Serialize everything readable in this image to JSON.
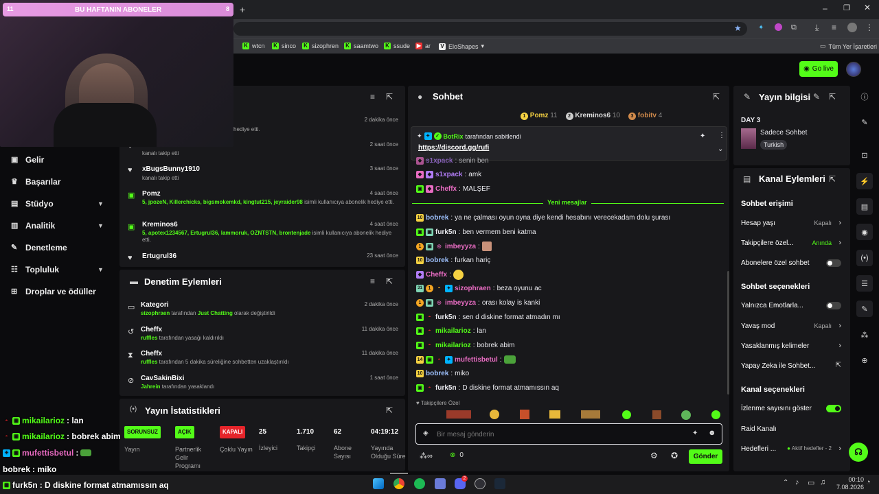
{
  "webcam": {
    "banner_left": "11",
    "banner_text": "BU HAFTANIN ABONELER",
    "banner_right": "8"
  },
  "browser": {
    "new_tab": "+",
    "bookmarks": [
      {
        "label": "wtcn"
      },
      {
        "label": "sinco"
      },
      {
        "label": "sizophren"
      },
      {
        "label": "saamtwo"
      },
      {
        "label": "ssude"
      },
      {
        "label": "ar"
      },
      {
        "label": "EloShapes"
      }
    ],
    "all_bookmarks": "Tüm Yer İşaretleri"
  },
  "header": {
    "go_live": "Go live"
  },
  "sidebar": {
    "items": [
      {
        "label": "Gelir"
      },
      {
        "label": "Başarılar"
      },
      {
        "label": "Stüdyo"
      },
      {
        "label": "Analitik"
      },
      {
        "label": "Denetleme"
      },
      {
        "label": "Topluluk"
      },
      {
        "label": "Droplar ve ödüller"
      }
    ]
  },
  "activity": {
    "rows": [
      {
        "name": "",
        "sub": "hediye etti.",
        "time": "2 dakika önce"
      },
      {
        "name": "",
        "sub": "kanalı takip etti",
        "time": "2 saat önce"
      },
      {
        "name": "xBugsBunny1910",
        "sub": "kanalı takip etti",
        "time": "3 saat önce"
      },
      {
        "name": "Pomz",
        "sub_green": "5, jpozeN, Killerchicks, bigsmokemkd, kingtut215, jeyraider98",
        "sub": " isimli kullanıcıya abonelik hediye etti.",
        "time": "4 saat önce"
      },
      {
        "name": "Kreminos6",
        "sub_green": "5, apotex1234567, Ertugrul36, lammoruk, OZNTSTN, brontenjade",
        "sub": " isimli kullanıcıya abonelik hediye etti.",
        "time": "4 saat önce"
      },
      {
        "name": "Ertugrul36",
        "sub": "",
        "time": "23 saat önce"
      }
    ]
  },
  "moderation": {
    "title": "Denetim Eylemleri",
    "rows": [
      {
        "name": "Kategori",
        "actor": "sizophraen",
        "mid": " tarafından ",
        "target": "Just Chatting",
        "end": " olarak değiştirildi",
        "time": "2 dakika önce"
      },
      {
        "name": "Cheffx",
        "actor": "ruffles",
        "mid": " tarafından yasağı kaldırıldı",
        "target": "",
        "end": "",
        "time": "11 dakika önce"
      },
      {
        "name": "Cheffx",
        "actor": "ruffles",
        "mid": " tarafından 5 dakika süreliğine sohbetten uzaklaştırıldı",
        "target": "",
        "end": "",
        "time": "11 dakika önce"
      },
      {
        "name": "CavSakinBixi",
        "actor": "Jahrein",
        "mid": " tarafından yasaklandı",
        "target": "",
        "end": "",
        "time": "1 saat önce"
      }
    ]
  },
  "stats": {
    "title": "Yayın İstatistikleri",
    "items": [
      {
        "tag": "SORUNSUZ",
        "tag_color": "#53fc18",
        "label": "Yayın"
      },
      {
        "tag": "AÇIK",
        "tag_color": "#53fc18",
        "label": "Partnerlik Gelir Programı"
      },
      {
        "tag": "KAPALI",
        "tag_color": "#e5242a",
        "label": "Çoklu Yayın"
      },
      {
        "value": "25",
        "label": "İzleyici"
      },
      {
        "value": "1.710",
        "label": "Takipçi"
      },
      {
        "value": "62",
        "label": "Abone Sayısı"
      },
      {
        "value": "04:19:12",
        "label": "Yayında Olduğu Süre"
      }
    ]
  },
  "chat": {
    "title": "Sohbet",
    "top_gifters": [
      {
        "name": "Pomz",
        "count": "11"
      },
      {
        "name": "Kreminos6",
        "count": "10"
      },
      {
        "name": "fobitv",
        "count": "4"
      }
    ],
    "pinned": {
      "by": "BotRix",
      "by_suffix": "tarafından sabitlendi",
      "link": "https://discord.gg/rufi"
    },
    "messages_before": [
      {
        "user": "s1xpack",
        "text": "senin ben",
        "color": "#b17cf5"
      },
      {
        "user": "s1xpack",
        "text": "amk",
        "color": "#b17cf5"
      },
      {
        "user": "Cheffx",
        "text": "MALŞEF",
        "color": "#e86cc2"
      }
    ],
    "new_divider": "Yeni mesajlar",
    "messages": [
      {
        "badge": "10",
        "user": "bobrek",
        "text": "ya ne çalması oyun oyna diye kendi hesabını verecekadam dolu şurası",
        "color": "#9fc2ff"
      },
      {
        "user": "furk5n",
        "text": "ben vermem beni katma",
        "color": "#ffffff"
      },
      {
        "user": "imbeyyza",
        "text": "",
        "color": "#e86cc2"
      },
      {
        "badge": "10",
        "user": "bobrek",
        "text": "furkan hariç",
        "color": "#9fc2ff"
      },
      {
        "user": "Cheffx",
        "text": "",
        "color": "#e86cc2"
      },
      {
        "user": "sizophraen",
        "text": "beza oyunu ac",
        "color": "#e86cc2"
      },
      {
        "user": "imbeyyza",
        "text": "orası kolay is kanki",
        "color": "#e86cc2"
      },
      {
        "user": "furk5n",
        "text": "sen d diskine format atmadın mı",
        "color": "#ffffff"
      },
      {
        "user": "mikailarioz",
        "text": "lan",
        "color": "#53fc18"
      },
      {
        "user": "mikailarioz",
        "text": "bobrek abim",
        "color": "#53fc18"
      },
      {
        "badge": "14",
        "user": "mufettisbetul",
        "text": "",
        "color": "#e86cc2"
      },
      {
        "badge": "10",
        "user": "bobrek",
        "text": "miko",
        "color": "#9fc2ff"
      },
      {
        "user": "furk5n",
        "text": "D diskine format atmamıssın aq",
        "color": "#ffffff"
      }
    ],
    "emote_label": "Takipçilere Özel",
    "input_placeholder": "Bir mesaj gönderin",
    "points": "0",
    "send": "Gönder"
  },
  "stream_info": {
    "title": "Yayın bilgisi",
    "stream_title": "DAY 3",
    "category": "Sadece Sohbet",
    "language": "Turkish"
  },
  "channel_actions": {
    "title": "Kanal Eylemleri",
    "chat_access": "Sohbet erişimi",
    "account_age": {
      "label": "Hesap yaşı",
      "value": "Kapalı"
    },
    "followers": {
      "label": "Takipçilere özel...",
      "value": "Anında"
    },
    "subs_only": {
      "label": "Abonelere özel sohbet"
    },
    "chat_options": "Sohbet seçenekleri",
    "emotes_only": {
      "label": "Yalnızca Emotlarla..."
    },
    "slow_mode": {
      "label": "Yavaş mod",
      "value": "Kapalı"
    },
    "banned_words": {
      "label": "Yasaklanmış kelimeler"
    },
    "ai_chat": {
      "label": "Yapay Zeka ile Sohbet..."
    },
    "channel_options": "Kanal seçenekleri",
    "viewer_count": {
      "label": "İzlenme sayısını göster"
    },
    "raid": {
      "label": "Raid Kanalı"
    },
    "goals": {
      "label": "Hedefleri ...",
      "value": "Aktif hedefler - 2"
    }
  },
  "overlay_chat": [
    {
      "user": "mikailarioz",
      "text": ": lan",
      "color": "#53fc18"
    },
    {
      "user": "mikailarioz",
      "text": ": bobrek abim",
      "color": "#53fc18"
    },
    {
      "user": "mufettisbetul",
      "text": ":",
      "color": "#e86cc2"
    },
    {
      "user": "bobrek",
      "text": ": miko",
      "color": "#ffffff"
    },
    {
      "user": "furk5n",
      "text": ": D diskine format atmamıssın aq",
      "color": "#ffffff"
    }
  ],
  "taskbar": {
    "time": "00:10",
    "date": "7.08.2026",
    "badge": "2"
  }
}
